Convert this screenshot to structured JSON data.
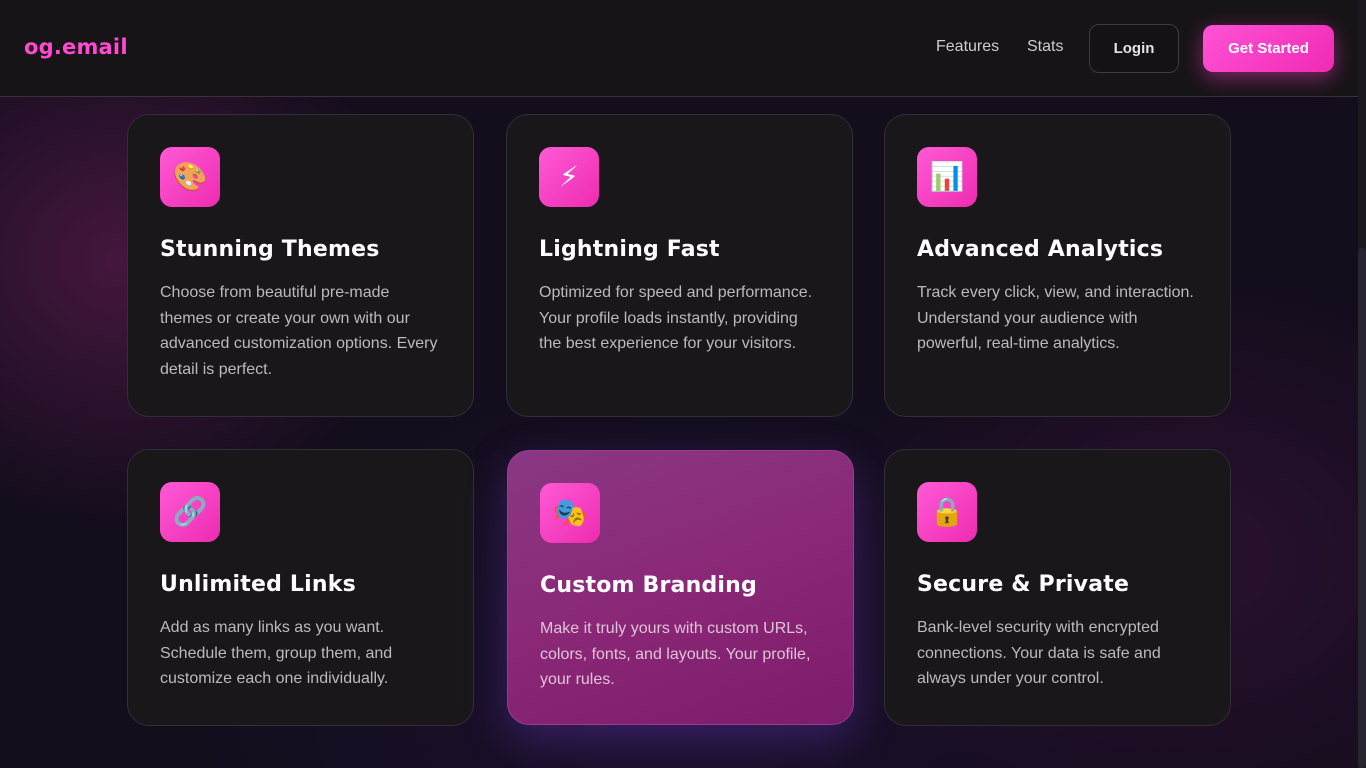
{
  "nav": {
    "logo": "og.email",
    "links": [
      "Features",
      "Stats"
    ],
    "login_label": "Login",
    "cta_label": "Get Started"
  },
  "features": [
    {
      "icon": "palette-icon",
      "glyph": "🎨",
      "title": "Stunning Themes",
      "description": "Choose from beautiful pre-made themes or create your own with our advanced customization options. Every detail is perfect."
    },
    {
      "icon": "lightning-icon",
      "glyph": "⚡",
      "title": "Lightning Fast",
      "description": "Optimized for speed and performance. Your profile loads instantly, providing the best experience for your visitors."
    },
    {
      "icon": "bar-chart-icon",
      "glyph": "📊",
      "title": "Advanced Analytics",
      "description": "Track every click, view, and interaction. Understand your audience with powerful, real-time analytics."
    },
    {
      "icon": "link-icon",
      "glyph": "🔗",
      "title": "Unlimited Links",
      "description": "Add as many links as you want. Schedule them, group them, and customize each one individually."
    },
    {
      "icon": "theater-masks-icon",
      "glyph": "🎭",
      "title": "Custom Branding",
      "description": "Make it truly yours with custom URLs, colors, fonts, and layouts. Your profile, your rules."
    },
    {
      "icon": "lock-icon",
      "glyph": "🔒",
      "title": "Secure & Private",
      "description": "Bank-level security with encrypted connections. Your data is safe and always under your control."
    }
  ],
  "colors": {
    "accent": "#ff4ad0",
    "background": "#130d1c",
    "card": "#1a171b",
    "highlight_card": "#8a2877"
  }
}
